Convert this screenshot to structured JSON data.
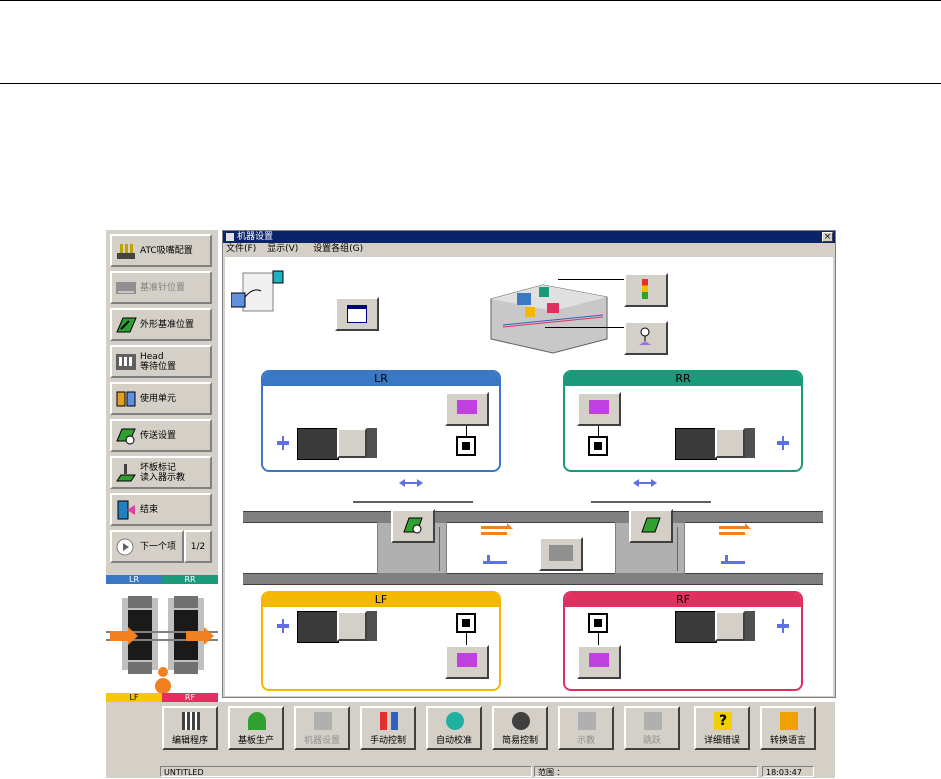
{
  "left_panel": {
    "buttons": [
      {
        "label": "ATC吸嘴配置",
        "icon": "nozzle-icon",
        "enabled": true
      },
      {
        "label": "基准针位置",
        "icon": "pin-icon",
        "enabled": false
      },
      {
        "label": "外形基准位置",
        "icon": "board-outline-icon",
        "enabled": true
      },
      {
        "label": "Head\n等待位置",
        "icon": "head-icon",
        "enabled": true
      },
      {
        "label": "使用单元",
        "icon": "unit-icon",
        "enabled": true
      },
      {
        "label": "传送设置",
        "icon": "conveyor-hand-icon",
        "enabled": true
      },
      {
        "label": "坏板标记\n读入器示教",
        "icon": "bad-mark-icon",
        "enabled": true
      },
      {
        "label": "结束",
        "icon": "exit-door-icon",
        "enabled": true
      }
    ],
    "next_label": "下一个项",
    "page_label": "1/2",
    "diagram": {
      "lr": "LR",
      "rr": "RR",
      "lf": "LF",
      "rf": "RF"
    }
  },
  "window": {
    "title": "机器设置",
    "close_glyph": "×",
    "menus": [
      "文件(F)",
      "显示(V)",
      "设置各组(G)"
    ]
  },
  "panels": {
    "lr": {
      "title": "LR",
      "color": "#3a78c4"
    },
    "rr": {
      "title": "RR",
      "color": "#1a9a7a"
    },
    "lf": {
      "title": "LF",
      "color": "#f5b800"
    },
    "rf": {
      "title": "RF",
      "color": "#e03060"
    }
  },
  "bottom_bar": {
    "buttons": [
      {
        "label": "编辑程序",
        "icon": "edit-program-icon",
        "enabled": true
      },
      {
        "label": "基板生产",
        "icon": "production-icon",
        "enabled": true
      },
      {
        "label": "机器设置",
        "icon": "machine-setup-icon",
        "enabled": false
      },
      {
        "label": "手动控制",
        "icon": "manual-control-icon",
        "enabled": true
      },
      {
        "label": "自动校准",
        "icon": "auto-calibrate-icon",
        "enabled": true
      },
      {
        "label": "简易控制",
        "icon": "simple-control-icon",
        "enabled": true
      },
      {
        "label": "示教",
        "icon": "teach-icon",
        "enabled": false
      },
      {
        "label": "跳跃",
        "icon": "jump-icon",
        "enabled": false
      },
      {
        "label": "详细错误",
        "icon": "help-question-icon",
        "enabled": true
      },
      {
        "label": "转换语言",
        "icon": "language-icon",
        "enabled": true
      }
    ]
  },
  "status": {
    "program": "UNTITLED",
    "range_label": "范围 ：",
    "time": "18:03:47"
  }
}
